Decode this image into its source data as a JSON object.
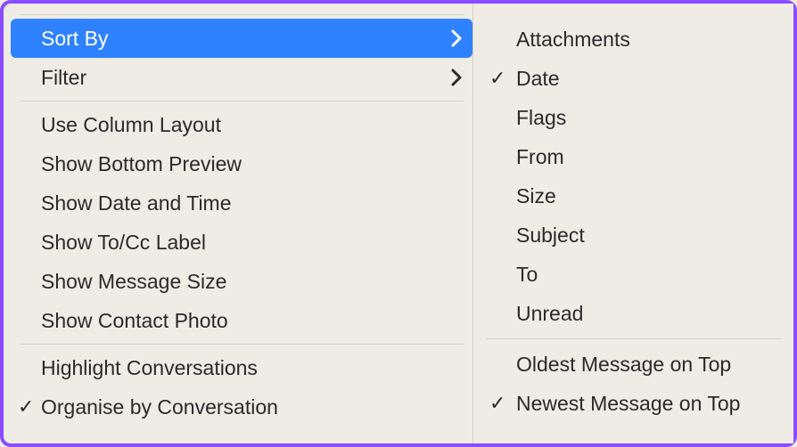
{
  "left_menu": {
    "group1": [
      {
        "label": "Sort By",
        "has_submenu": true,
        "highlighted": true
      },
      {
        "label": "Filter",
        "has_submenu": true
      }
    ],
    "group2": [
      {
        "label": "Use Column Layout"
      },
      {
        "label": "Show Bottom Preview"
      },
      {
        "label": "Show Date and Time"
      },
      {
        "label": "Show To/Cc Label"
      },
      {
        "label": "Show Message Size"
      },
      {
        "label": "Show Contact Photo"
      }
    ],
    "group3": [
      {
        "label": "Highlight Conversations"
      },
      {
        "label": "Organise by Conversation",
        "checked": true
      }
    ]
  },
  "sort_submenu": {
    "group1": [
      {
        "label": "Attachments"
      },
      {
        "label": "Date",
        "checked": true
      },
      {
        "label": "Flags"
      },
      {
        "label": "From"
      },
      {
        "label": "Size"
      },
      {
        "label": "Subject"
      },
      {
        "label": "To"
      },
      {
        "label": "Unread"
      }
    ],
    "group2": [
      {
        "label": "Oldest Message on Top"
      },
      {
        "label": "Newest Message on Top",
        "checked": true
      }
    ]
  },
  "colors": {
    "highlight": "#2f82ff",
    "background": "#efece6",
    "border": "#8a4dff"
  }
}
